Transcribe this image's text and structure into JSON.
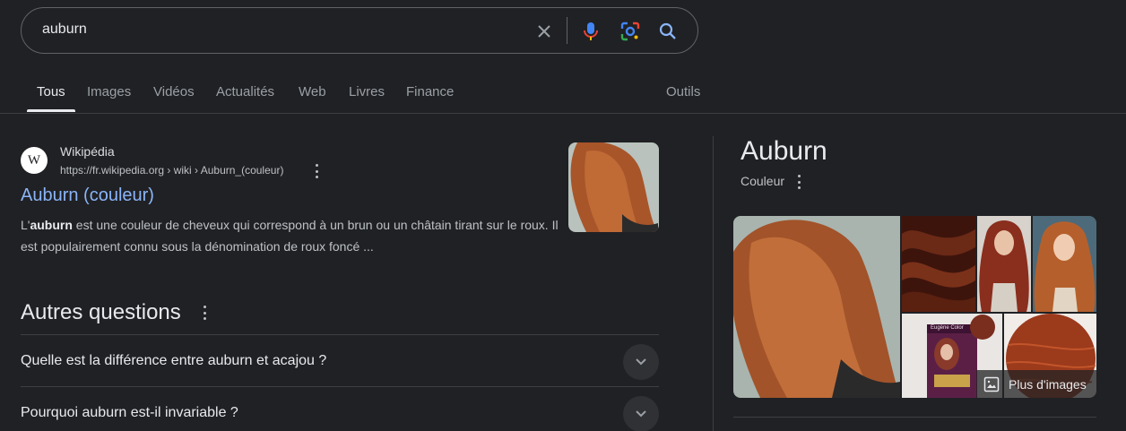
{
  "search": {
    "query": "auburn",
    "icons": [
      "clear-icon",
      "mic-icon",
      "lens-icon",
      "search-icon"
    ]
  },
  "tabs": [
    {
      "label": "Tous",
      "active": true
    },
    {
      "label": "Images"
    },
    {
      "label": "Vidéos"
    },
    {
      "label": "Actualités"
    },
    {
      "label": "Web"
    },
    {
      "label": "Livres"
    },
    {
      "label": "Finance"
    }
  ],
  "tools_label": "Outils",
  "result": {
    "favicon_letter": "W",
    "site_name": "Wikipédia",
    "url": "https://fr.wikipedia.org › wiki › Auburn_(couleur)",
    "title": "Auburn (couleur)",
    "snippet_prefix": "L'",
    "snippet_bold": "auburn",
    "snippet_rest": " est une couleur de cheveux qui correspond à un brun ou un châtain tirant sur le roux. Il est populairement connu sous la dénomination de roux foncé ..."
  },
  "paa": {
    "title": "Autres questions",
    "questions": [
      "Quelle est la différence entre auburn et acajou ?",
      "Pourquoi auburn est-il invariable ?"
    ]
  },
  "knowledge_panel": {
    "title": "Auburn",
    "subtitle": "Couleur",
    "more_images_label": "Plus d'images",
    "product_box_text": "Eugène Color"
  },
  "colors": {
    "background": "#202124",
    "link": "#8ab4f8",
    "text": "#bdc1c6",
    "divider": "#3c4043"
  }
}
